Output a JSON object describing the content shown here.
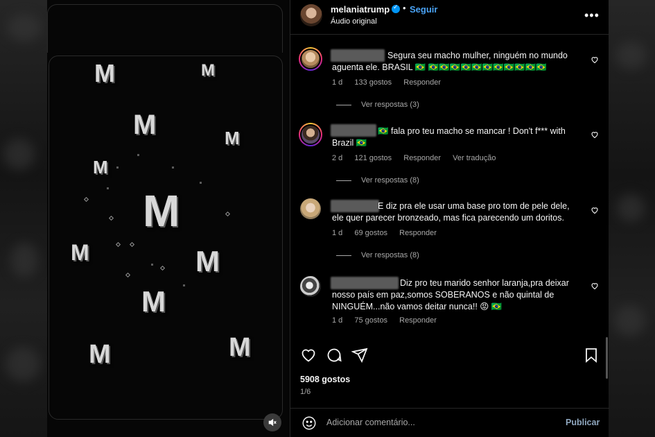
{
  "post": {
    "username": "melaniatrump",
    "follow_label": "Seguir",
    "audio": "Áudio original",
    "more_icon": "more-horizontal-icon",
    "likes": "5908 gostos",
    "pager": "1/6"
  },
  "video": {
    "logo_letter": "M",
    "mute_icon": "speaker-muted-icon"
  },
  "comments": [
    {
      "text": "Segura seu macho mulher, ninguém no mundo aguenta ele. BRASIL 🇧🇷 🇧🇷🇧🇷🇧🇷🇧🇷🇧🇷🇧🇷🇧🇷🇧🇷🇧🇷🇧🇷🇧🇷",
      "time": "1 d",
      "likes": "133 gostos",
      "reply": "Responder",
      "translate": "",
      "replies": "Ver respostas (3)"
    },
    {
      "text": "🇧🇷 fala pro teu macho se mancar ! Don't f*** with Brazil 🇧🇷",
      "time": "2 d",
      "likes": "121 gostos",
      "reply": "Responder",
      "translate": "Ver tradução",
      "replies": "Ver respostas (8)"
    },
    {
      "text": "E diz pra ele usar uma base pro tom de pele dele, ele quer parecer bronzeado, mas fica parecendo um doritos.",
      "time": "1 d",
      "likes": "69 gostos",
      "reply": "Responder",
      "translate": "",
      "replies": "Ver respostas (8)"
    },
    {
      "text": "Diz pro teu marido senhor laranja,pra deixar nosso país em paz,somos SOBERANOS e não quintal de NINGUÉM...não vamos deitar nunca!! 😡 🇧🇷",
      "time": "1 d",
      "likes": "75 gostos",
      "reply": "Responder",
      "translate": "",
      "replies": ""
    }
  ],
  "composer": {
    "placeholder": "Adicionar comentário...",
    "publish": "Publicar"
  },
  "colors": {
    "accent": "#4aa3f5",
    "background": "#000000",
    "muted_text": "#a8a8a8"
  }
}
